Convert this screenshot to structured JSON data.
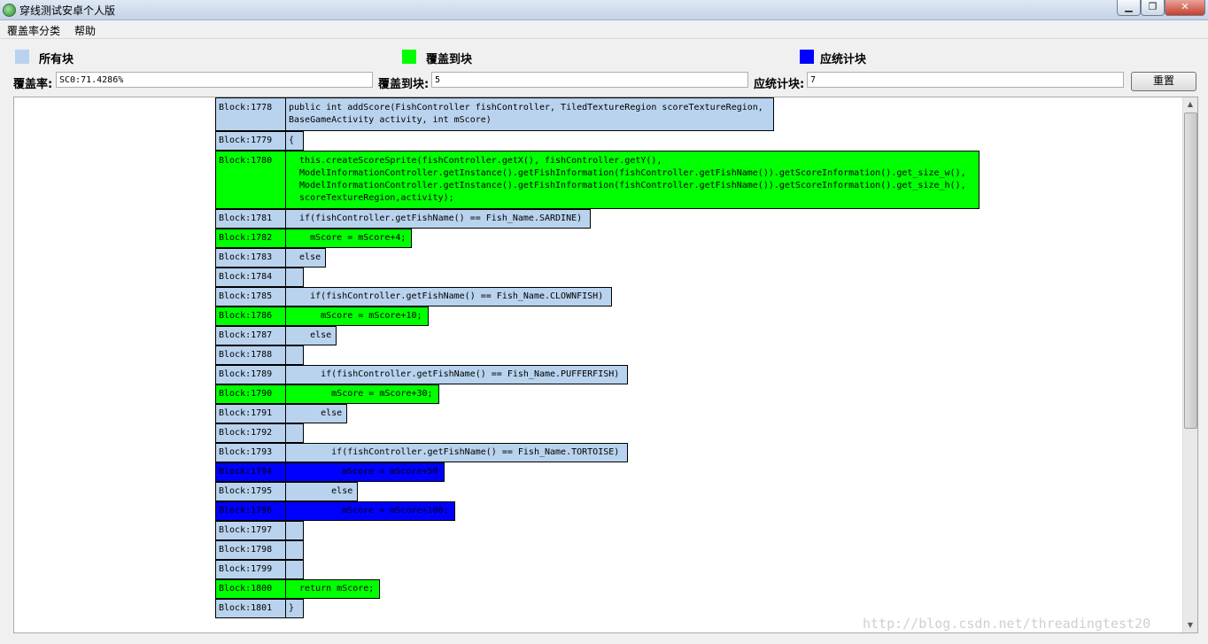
{
  "window": {
    "title": "穿线测试安卓个人版",
    "minimize_glyph": "▁",
    "maximize_glyph": "❐",
    "close_glyph": "✕"
  },
  "menu": {
    "items": [
      "覆盖率分类",
      "帮助"
    ]
  },
  "legend": [
    {
      "label": "所有块",
      "color": "#b9d3ee"
    },
    {
      "label": "覆盖到块",
      "color": "#00ff00"
    },
    {
      "label": "应统计块",
      "color": "#0000ff"
    }
  ],
  "stats": {
    "coverage_label": "覆盖率:",
    "coverage_value": "SC0:71.4286%",
    "covered_label": "覆盖到块:",
    "covered_value": "5",
    "expected_label": "应统计块:",
    "expected_value": "7",
    "reset_label": "重置"
  },
  "blocks": [
    {
      "id": "Block:1778",
      "status": "all",
      "code": "public int addScore(FishController fishController, TiledTextureRegion scoreTextureRegion,\nBaseGameActivity activity, int mScore)"
    },
    {
      "id": "Block:1779",
      "status": "all",
      "code": "{"
    },
    {
      "id": "Block:1780",
      "status": "covered",
      "code": "  this.createScoreSprite(fishController.getX(), fishController.getY(),\n  ModelInformationController.getInstance().getFishInformation(fishController.getFishName()).getScoreInformation().get_size_w(),\n  ModelInformationController.getInstance().getFishInformation(fishController.getFishName()).getScoreInformation().get_size_h(),\n  scoreTextureRegion,activity);"
    },
    {
      "id": "Block:1781",
      "status": "all",
      "code": "  if(fishController.getFishName() == Fish_Name.SARDINE)"
    },
    {
      "id": "Block:1782",
      "status": "covered",
      "code": "    mScore = mScore+4;"
    },
    {
      "id": "Block:1783",
      "status": "all",
      "code": "  else"
    },
    {
      "id": "Block:1784",
      "status": "all",
      "code": ""
    },
    {
      "id": "Block:1785",
      "status": "all",
      "code": "    if(fishController.getFishName() == Fish_Name.CLOWNFISH)"
    },
    {
      "id": "Block:1786",
      "status": "covered",
      "code": "      mScore = mScore+10;"
    },
    {
      "id": "Block:1787",
      "status": "all",
      "code": "    else"
    },
    {
      "id": "Block:1788",
      "status": "all",
      "code": ""
    },
    {
      "id": "Block:1789",
      "status": "all",
      "code": "      if(fishController.getFishName() == Fish_Name.PUFFERFISH)"
    },
    {
      "id": "Block:1790",
      "status": "covered",
      "code": "        mScore = mScore+30;"
    },
    {
      "id": "Block:1791",
      "status": "all",
      "code": "      else"
    },
    {
      "id": "Block:1792",
      "status": "all",
      "code": ""
    },
    {
      "id": "Block:1793",
      "status": "all",
      "code": "        if(fishController.getFishName() == Fish_Name.TORTOISE)"
    },
    {
      "id": "Block:1794",
      "status": "statistic",
      "code": "          mScore = mScore+50"
    },
    {
      "id": "Block:1795",
      "status": "all",
      "code": "        else"
    },
    {
      "id": "Block:1796",
      "status": "statistic",
      "code": "          mScore = mScore+100;"
    },
    {
      "id": "Block:1797",
      "status": "all",
      "code": ""
    },
    {
      "id": "Block:1798",
      "status": "all",
      "code": ""
    },
    {
      "id": "Block:1799",
      "status": "all",
      "code": ""
    },
    {
      "id": "Block:1800",
      "status": "covered",
      "code": "  return mScore;"
    },
    {
      "id": "Block:1801",
      "status": "all",
      "code": "}"
    }
  ],
  "watermark": "http://blog.csdn.net/threadingtest20"
}
